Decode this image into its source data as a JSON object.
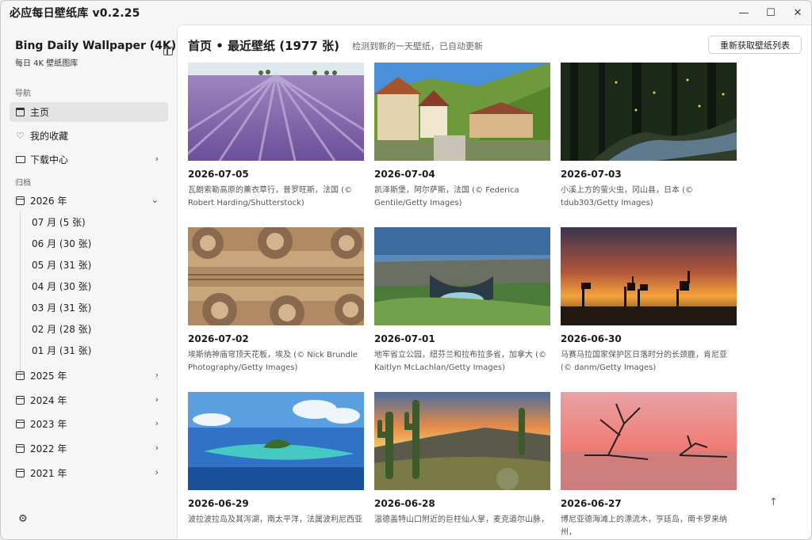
{
  "window": {
    "title": "必应每日壁纸库 v0.2.25",
    "controls": [
      "—",
      "☐",
      "✕"
    ]
  },
  "sidebar": {
    "brand_title": "Bing Daily Wallpaper (4K)",
    "brand_sub": "每日 4K 壁纸图库",
    "nav_label": "导航",
    "nav": [
      {
        "label": "主页",
        "icon": "home-icon"
      },
      {
        "label": "我的收藏",
        "icon": "heart-icon"
      },
      {
        "label": "下载中心",
        "icon": "folder-icon"
      }
    ],
    "archive_label": "归档",
    "years": [
      "2026 年",
      "2025 年",
      "2024 年",
      "2023 年",
      "2022 年",
      "2021 年"
    ],
    "months": [
      "07 月 (5 张)",
      "06 月 (30 张)",
      "05 月 (31 张)",
      "04 月 (30 张)",
      "03 月 (31 张)",
      "02 月 (28 张)",
      "01 月 (31 张)"
    ]
  },
  "main": {
    "title": "首页 • 最近壁纸 (1977 张)",
    "status": "检测到新的一天壁纸，已自动更新",
    "refresh_label": "重新获取壁纸列表",
    "cards": [
      {
        "date": "2026-07-05",
        "caption": "瓦朗索勒高原的薰衣草行，普罗旺斯，法国 (© Robert Harding/Shutterstock)"
      },
      {
        "date": "2026-07-04",
        "caption": "凯泽斯堡，阿尔萨斯，法国 (© Federica Gentile/Getty Images)"
      },
      {
        "date": "2026-07-03",
        "caption": "小溪上方的萤火虫，冈山县，日本 (© tdub303/Getty Images)"
      },
      {
        "date": "2026-07-02",
        "caption": "埃斯纳神庙穹顶天花板，埃及 (© Nick Brundle Photography/Getty Images)"
      },
      {
        "date": "2026-07-01",
        "caption": "地牢省立公园，纽芬兰和拉布拉多省，加拿大 (© Kaitlyn McLachlan/Getty Images)"
      },
      {
        "date": "2026-06-30",
        "caption": "马赛马拉国家保护区日落时分的长颈鹿，肯尼亚 (© danm/Getty Images)"
      },
      {
        "date": "2026-06-29",
        "caption": "波拉波拉岛及其泻湖，南太平洋，法属波利尼西亚"
      },
      {
        "date": "2026-06-28",
        "caption": "温德盖特山口附近的巨柱仙人掌，麦克道尔山脉，"
      },
      {
        "date": "2026-06-27",
        "caption": "博尼亚德海滩上的漂流木，亨廷岛，南卡罗来纳州，"
      }
    ]
  }
}
